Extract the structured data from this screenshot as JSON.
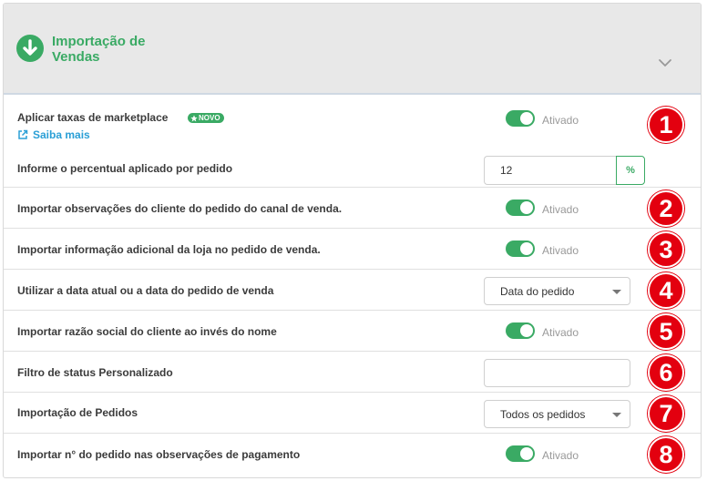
{
  "header": {
    "title": "Importação de Vendas",
    "accent_color": "#3aaa64",
    "icon": "download-arrow-icon"
  },
  "rows": [
    {
      "label": "Aplicar taxas de marketplace",
      "badge": "NOVO",
      "link": "Saiba mais",
      "toggle_state": "Ativado",
      "marker": "1",
      "sub_label": "Informe o percentual aplicado por pedido",
      "input_value": "12",
      "addon": "%"
    },
    {
      "label": "Importar observações do cliente do pedido do canal de venda.",
      "toggle_state": "Ativado",
      "marker": "2"
    },
    {
      "label": "Importar informação adicional da loja no pedido de venda.",
      "toggle_state": "Ativado",
      "marker": "3"
    },
    {
      "label": "Utilizar a data atual ou a data do pedido de venda",
      "select_value": "Data do pedido",
      "marker": "4"
    },
    {
      "label": "Importar razão social do cliente ao invés do nome",
      "toggle_state": "Ativado",
      "marker": "5"
    },
    {
      "label": "Filtro de status Personalizado",
      "input_value": "",
      "marker": "6"
    },
    {
      "label": "Importação de Pedidos",
      "select_value": "Todos os pedidos",
      "marker": "7"
    },
    {
      "label": "Importar n° do pedido nas observações de pagamento",
      "toggle_state": "Ativado",
      "marker": "8"
    }
  ],
  "colors": {
    "toggle_on": "#3aaa64",
    "link": "#2a9fd6",
    "marker": "#e3000f"
  }
}
